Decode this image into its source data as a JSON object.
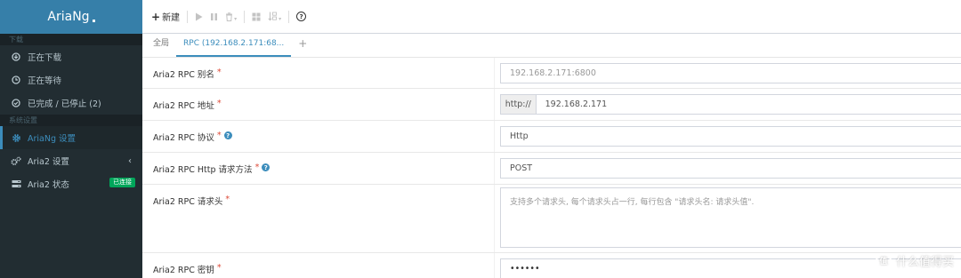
{
  "app": {
    "title": "AriaNg"
  },
  "sidebar": {
    "section_download": "下载",
    "section_settings": "系统设置",
    "items": [
      {
        "label": "正在下载",
        "icon": "download-circle-icon"
      },
      {
        "label": "正在等待",
        "icon": "clock-icon"
      },
      {
        "label": "已完成 / 已停止 (2)",
        "icon": "check-circle-icon"
      },
      {
        "label": "AriaNg 设置",
        "icon": "gear-icon"
      },
      {
        "label": "Aria2 设置",
        "icon": "gears-icon"
      },
      {
        "label": "Aria2 状态",
        "icon": "server-icon",
        "badge": "已连接"
      }
    ]
  },
  "toolbar": {
    "new_label": "新建",
    "help_icon": "?"
  },
  "tabs": [
    {
      "label": "全局"
    },
    {
      "label": "RPC (192.168.2.171:68..."
    }
  ],
  "settings": {
    "rows": [
      {
        "label": "Aria2 RPC 别名",
        "required": "*",
        "value": "192.168.2.171:6800"
      },
      {
        "label": "Aria2 RPC 地址",
        "required": "*",
        "addon": "http://",
        "value": "192.168.2.171"
      },
      {
        "label": "Aria2 RPC 协议",
        "required": "*",
        "value": "Http"
      },
      {
        "label": "Aria2 RPC Http 请求方法",
        "required": "*",
        "value": "POST"
      },
      {
        "label": "Aria2 RPC 请求头",
        "required": "*",
        "placeholder": "支持多个请求头, 每个请求头占一行, 每行包含 \"请求头名: 请求头值\"."
      },
      {
        "label": "Aria2 RPC 密钥",
        "required": "*",
        "value": "••••••"
      }
    ]
  },
  "watermark": {
    "text": "什么值得买",
    "logo": "值"
  },
  "colors": {
    "sidebar_bg": "#222d32",
    "brand_bg": "#367fa9",
    "accent": "#3c8dbc",
    "badge": "#00a65a",
    "required": "#dd4b39"
  }
}
